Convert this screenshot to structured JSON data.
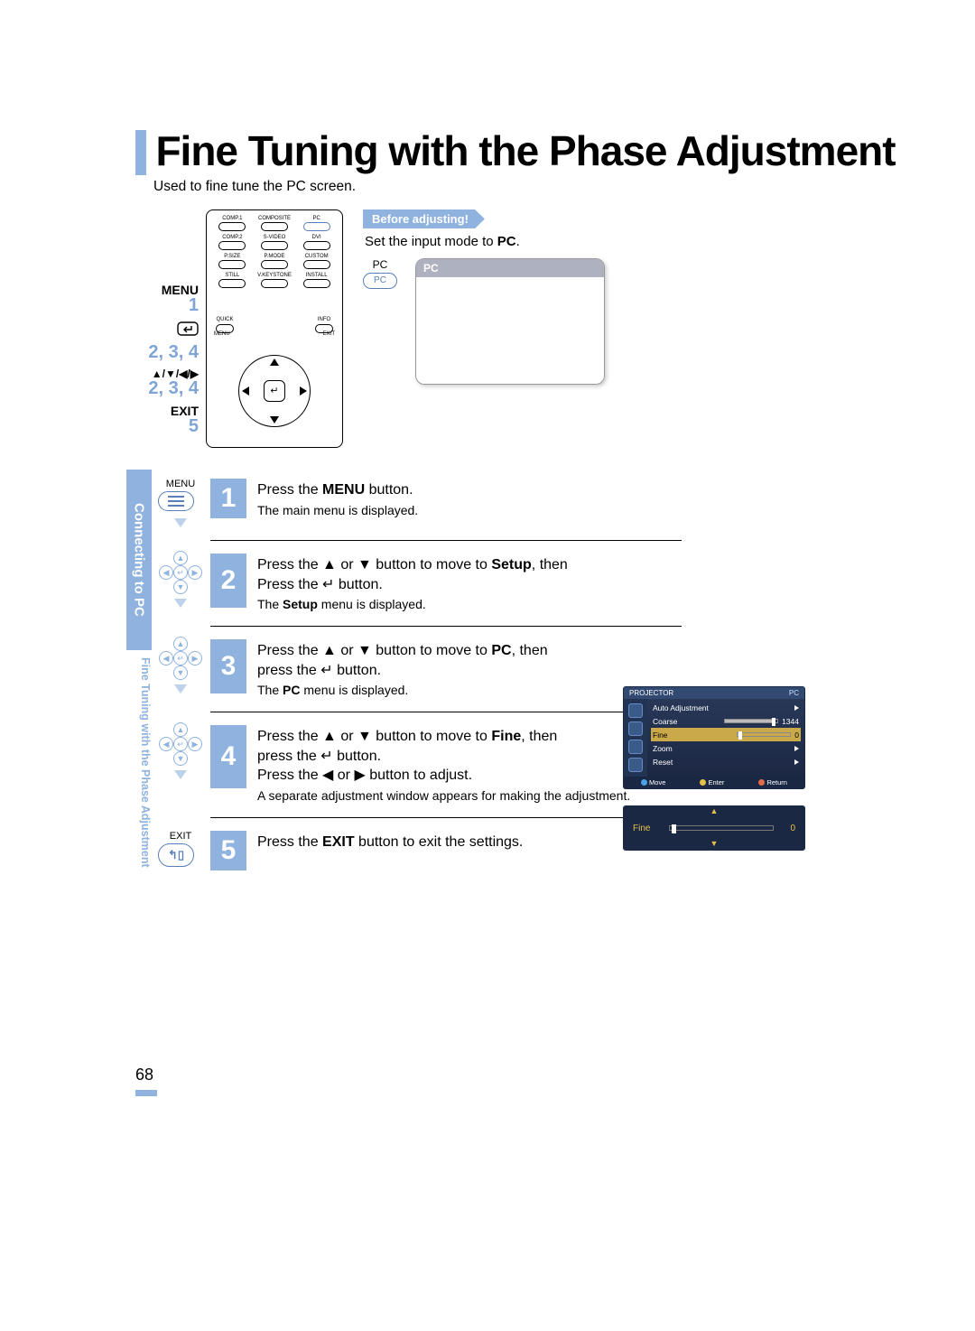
{
  "title": "Fine Tuning with the Phase Adjustment",
  "subtitle": "Used to fine tune the PC screen.",
  "side": {
    "section": "Connecting to PC",
    "topic": "Fine Tuning with the Phase Adjustment"
  },
  "remote": {
    "labels": {
      "menu": "MENU",
      "menu_step": "1",
      "arrows": "▲/▼/◀/▶",
      "arrows_step": "2, 3, 4",
      "enter_step": "2, 3, 4",
      "exit": "EXIT",
      "exit_step": "5"
    },
    "top_buttons": [
      "COMP.1",
      "COMPOSITE",
      "PC",
      "COMP.2",
      "S-VIDEO",
      "DVI",
      "P.SIZE",
      "P.MODE",
      "CUSTOM",
      "STILL",
      "V.KEYSTONE",
      "INSTALL"
    ],
    "mid_buttons": [
      "QUICK",
      "INFO"
    ],
    "arc_left": "MENU",
    "arc_right": "EXIT"
  },
  "before": {
    "tag": "Before adjusting!",
    "text_pre": "Set the input mode to ",
    "text_bold": "PC",
    "pc_label": "PC",
    "pc_text": "PC",
    "screen_header": "PC"
  },
  "steps": [
    {
      "num": "1",
      "icon": "menu",
      "icon_label": "MENU",
      "line1_pre": "Press the ",
      "line1_bold": "MENU",
      "line1_post": " button.",
      "sub": "The main menu is displayed."
    },
    {
      "num": "2",
      "icon": "nav",
      "line1_pre": "Press the ▲ or ▼ button to move to ",
      "line1_bold": "Setup",
      "line1_post": ", then",
      "line2": "Press the ↵ button.",
      "sub_pre": "The ",
      "sub_bold": "Setup",
      "sub_post": " menu is displayed."
    },
    {
      "num": "3",
      "icon": "nav",
      "line1_pre": "Press the ▲ or ▼ button to move to ",
      "line1_bold": "PC",
      "line1_post": ", then",
      "line2": "press the ↵ button.",
      "sub_pre": "The ",
      "sub_bold": "PC",
      "sub_post": " menu is displayed."
    },
    {
      "num": "4",
      "icon": "nav",
      "line1_pre": "Press the ▲ or ▼ button to move to ",
      "line1_bold": "Fine",
      "line1_post": ", then",
      "line2": "press the ↵ button.",
      "line3": "Press the ◀ or ▶ button to adjust.",
      "sub": "A separate adjustment window appears for making the adjustment."
    },
    {
      "num": "5",
      "icon": "exit",
      "icon_label": "EXIT",
      "line1_pre": "Press the ",
      "line1_bold": "EXIT",
      "line1_post": " button to exit the settings."
    }
  ],
  "osd_main": {
    "title_left": "PROJECTOR",
    "title_right": "PC",
    "rows": [
      {
        "k": "Auto Adjustment",
        "type": "arrow"
      },
      {
        "k": "Coarse",
        "type": "bar",
        "v": "1344",
        "fill": 90
      },
      {
        "k": "Fine",
        "type": "bar",
        "v": "0",
        "fill": 2,
        "sel": true
      },
      {
        "k": "Zoom",
        "type": "arrow"
      },
      {
        "k": "Reset",
        "type": "arrow"
      }
    ],
    "footer": [
      {
        "color": "#4aa3e4",
        "t": "Move"
      },
      {
        "color": "#e4c04a",
        "t": "Enter"
      },
      {
        "color": "#e46a4a",
        "t": "Return"
      }
    ]
  },
  "osd_slider": {
    "label": "Fine",
    "value": "0"
  },
  "page_number": "68"
}
